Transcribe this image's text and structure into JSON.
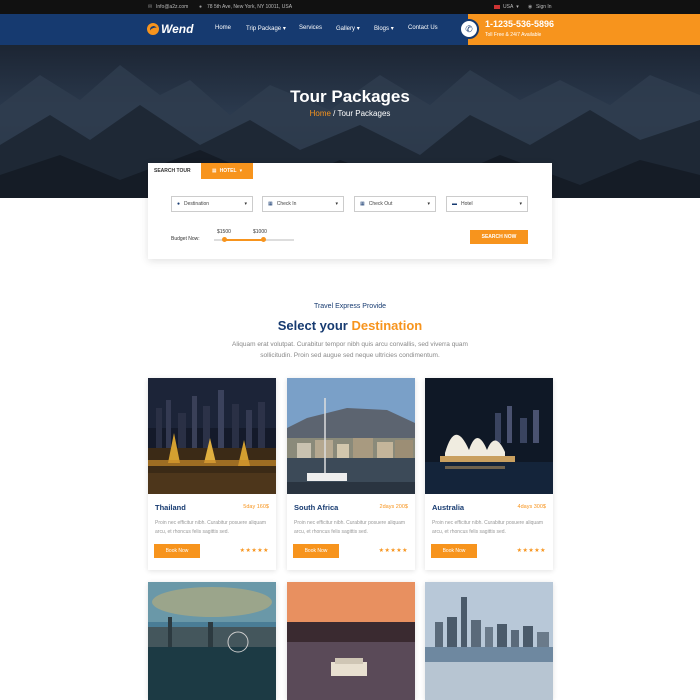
{
  "topbar": {
    "email": "Info@a2z.com",
    "address": "78 5th Ave, New York, NY 10011, USA",
    "language": "USA",
    "signin": "Sign In"
  },
  "header": {
    "logo": "Wend",
    "nav": [
      "Home",
      "Trip Package",
      "Services",
      "Gallery",
      "Blogs",
      "Contact Us"
    ],
    "phone": "1-1235-536-5896",
    "phone_sub": "Toll Free & 24/7 Available"
  },
  "hero": {
    "title": "Tour Packages",
    "crumb_home": "Home",
    "crumb_sep": " / ",
    "crumb_current": "Tour Packages"
  },
  "search": {
    "tab_tour": "SEARCH TOUR",
    "tab_hotel": "HOTEL",
    "fields": [
      "Destination",
      "Check In",
      "Check Out",
      "Hotel"
    ],
    "budget_label": "Budget Now:",
    "min_value": "$1500",
    "max_value": "$1000",
    "button": "SEARCH NOW"
  },
  "section": {
    "kicker": "Travel Express Provide",
    "title_plain": "Select your ",
    "title_accent": "Destination",
    "description": "Aliquam erat volutpat. Curabitur tempor nibh quis arcu convallis, sed viverra quam sollicitudin. Proin sed augue sed neque ultricies condimentum."
  },
  "cards": [
    {
      "name": "Thailand",
      "meta": "5day 160$",
      "desc": "Proin nec efficitur nibh. Curabitur posuere aliquam arcu, et rhoncus felis sagittis sed.",
      "button": "Book Now",
      "rating": 5
    },
    {
      "name": "South Africa",
      "meta": "2days 200$",
      "desc": "Proin nec efficitur nibh. Curabitur posuere aliquam arcu, et rhoncus felis sagittis sed.",
      "button": "Book Now",
      "rating": 5
    },
    {
      "name": "Australia",
      "meta": "4days 300$",
      "desc": "Proin nec efficitur nibh. Curabitur posuere aliquam arcu, et rhoncus felis sagittis sed.",
      "button": "Book Now",
      "rating": 5
    }
  ],
  "colors": {
    "brand": "#163a70",
    "accent": "#f7941d"
  }
}
